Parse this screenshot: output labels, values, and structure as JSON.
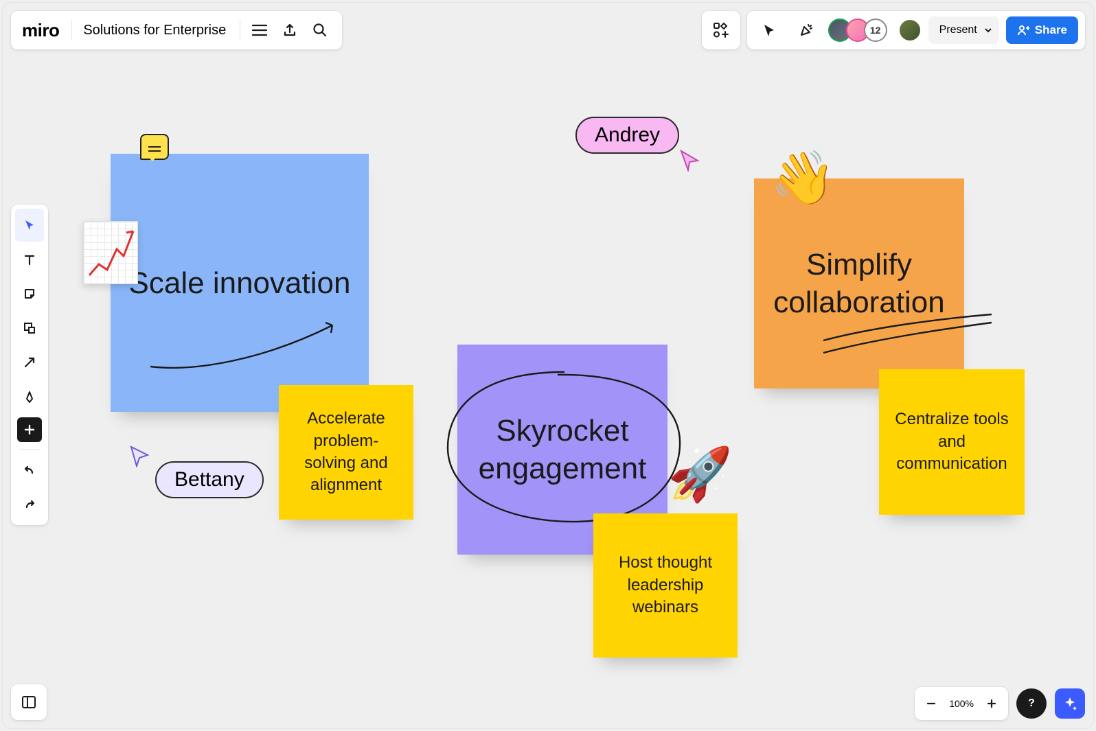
{
  "app": {
    "brand": "miro",
    "board_title": "Solutions for Enterprise"
  },
  "header": {
    "present_label": "Present",
    "share_label": "Share",
    "extra_users_count": "12"
  },
  "zoom": {
    "level": "100%",
    "help": "?"
  },
  "cursors": {
    "andrey": "Andrey",
    "bettany": "Bettany"
  },
  "notes": {
    "scale": "Scale innovation",
    "accelerate": "Accelerate problem-solving and alignment",
    "skyrocket": "Skyrocket engagement",
    "host": "Host thought leadership webinars",
    "simplify": "Simplify collaboration",
    "centralize": "Centralize tools and communication"
  },
  "emoji": {
    "wave": "👋",
    "rocket": "🚀"
  },
  "toolbar": {
    "select": "select-tool",
    "text": "text-tool",
    "sticky": "sticky-note-tool",
    "shape": "shape-tool",
    "arrow": "connector-tool",
    "pen": "pen-tool",
    "add": "add-tool",
    "undo": "undo",
    "redo": "redo"
  }
}
